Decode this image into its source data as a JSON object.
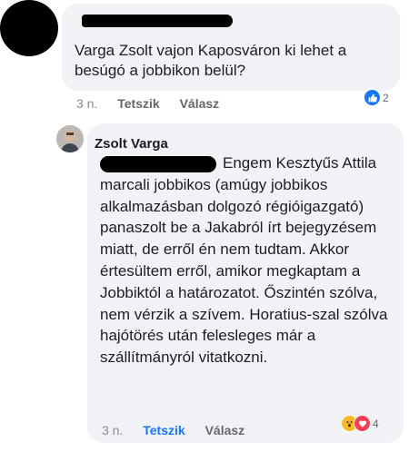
{
  "comment1": {
    "text": "Varga Zsolt vajon Kaposváron ki lehet a\nbesúgó a jobbikon belül?",
    "time": "3 n.",
    "like_label": "Tetszik",
    "reply_label": "Válasz",
    "reaction_count": "2",
    "reaction_icon": "like-icon"
  },
  "comment2": {
    "author": "Zsolt Varga",
    "text": "Engem Kesztyűs Attila marcali jobbikos (amúgy jobbikos alkalmazásban dolgozó régióigazgató) panaszolt be a Jakabról írt bejegyzésem miatt, de erről én nem tudtam. Akkor értesültem erről, amikor megkaptam a Jobbiktól a határozatot. Őszintén szólva, nem vérzik a szívem. Horatius-szal szólva hajótörés után felesleges már a szállítmányról vitatkozni.",
    "time": "3 n.",
    "like_label": "Tetszik",
    "reply_label": "Válasz",
    "reaction_count": "4",
    "reaction_icons": [
      "wow-icon",
      "heart-icon"
    ]
  },
  "colors": {
    "like_blue": "#1877f2",
    "bubble_bg": "#f0f2f5",
    "meta_gray": "#65676b"
  }
}
